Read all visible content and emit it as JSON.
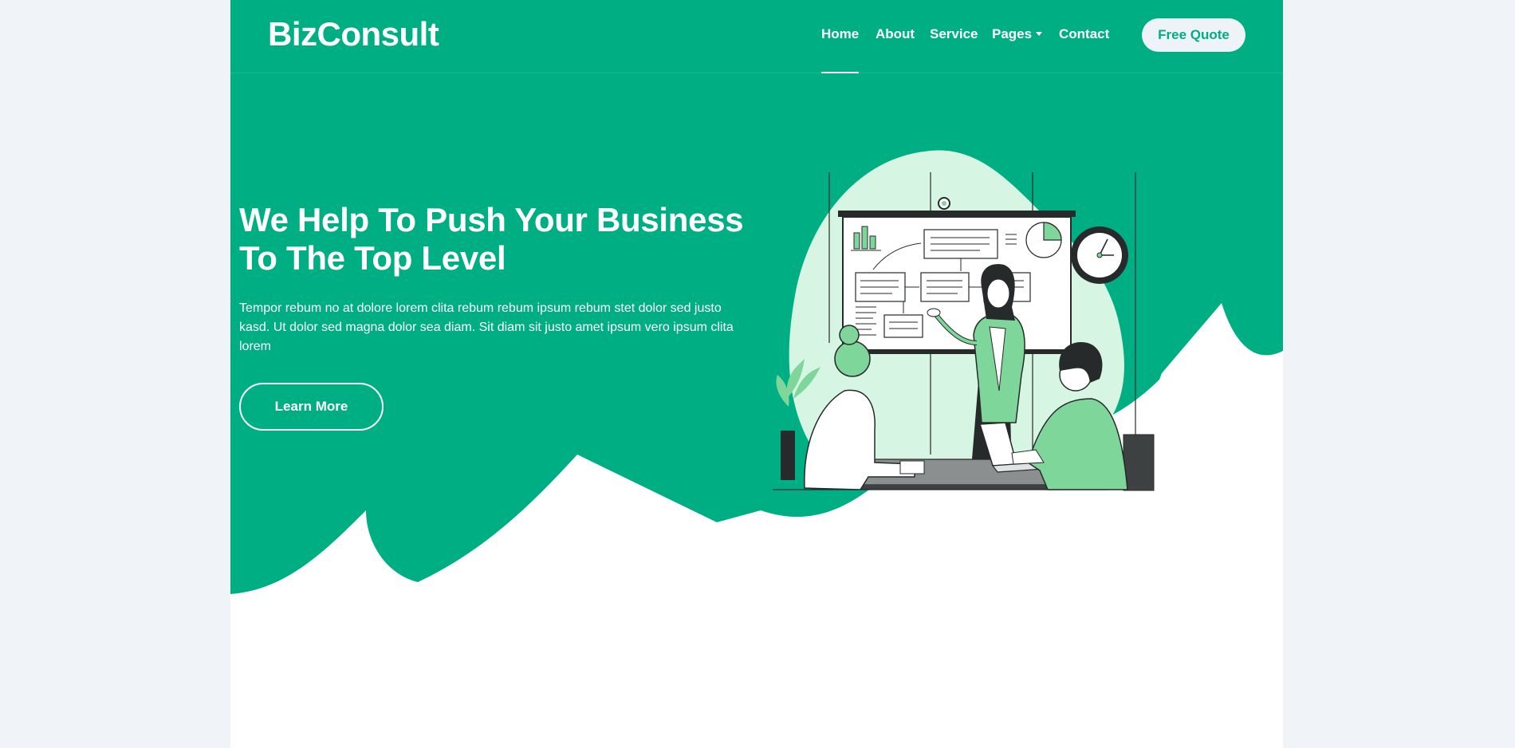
{
  "colors": {
    "brand": "#00ae84",
    "light_green": "#d7f5e3",
    "mid_green": "#7fd69a",
    "dark": "#262a2a"
  },
  "navbar": {
    "brand": "BizConsult",
    "links": [
      {
        "label": "Home",
        "active": true
      },
      {
        "label": "About"
      },
      {
        "label": "Service"
      },
      {
        "label": "Pages",
        "dropdown": true
      },
      {
        "label": "Contact"
      }
    ],
    "cta": "Free Quote"
  },
  "hero": {
    "title": "We Help To Push Your Business To The Top Level",
    "text": "Tempor rebum no at dolore lorem clita rebum rebum ipsum rebum stet dolor sed justo kasd. Ut dolor sed magna dolor sea diam. Sit diam sit justo amet ipsum vero ipsum clita lorem",
    "button": "Learn More"
  },
  "icons": [
    "chevron-down-icon",
    "clock-icon",
    "presentation-board-icon",
    "plant-icon"
  ]
}
